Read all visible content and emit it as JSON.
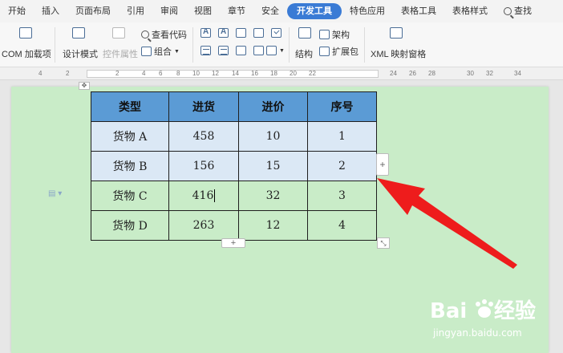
{
  "menu": {
    "items": [
      "开始",
      "插入",
      "页面布局",
      "引用",
      "审阅",
      "视图",
      "章节",
      "安全",
      "开发工具",
      "特色应用",
      "表格工具",
      "表格样式"
    ],
    "active": "开发工具",
    "search_label": "查找"
  },
  "ribbon": {
    "com_addins": "COM 加载项",
    "design_mode": "设计模式",
    "control_props": "控件属性",
    "view_code": "查看代码",
    "combine": "组合",
    "structure": "结构",
    "schema": "架构",
    "expansion_pack": "扩展包",
    "xml_mapping_pane": "XML 映射窗格"
  },
  "ruler": {
    "numbers": [
      "4",
      "2",
      "2",
      "4",
      "6",
      "8",
      "10",
      "12",
      "14",
      "16",
      "18",
      "20",
      "22",
      "24",
      "26",
      "28",
      "30",
      "32",
      "34"
    ]
  },
  "table": {
    "headers": [
      "类型",
      "进货",
      "进价",
      "序号"
    ],
    "rows": [
      [
        "货物 A",
        "458",
        "10",
        "1"
      ],
      [
        "货物 B",
        "156",
        "15",
        "2"
      ],
      [
        "货物 C",
        "416",
        "32",
        "3"
      ],
      [
        "货物 D",
        "263",
        "12",
        "4"
      ]
    ]
  },
  "handles": {
    "add_row": "+",
    "add_col": "+"
  },
  "watermark": {
    "url": "jingyan.baidu.com"
  },
  "colors": {
    "page_bg": "#c9ecc8",
    "header_fill": "#5b9bd5",
    "row_tint": "#dbe8f5",
    "active_tab": "#3a7bd5",
    "arrow": "#ee1c1c"
  }
}
